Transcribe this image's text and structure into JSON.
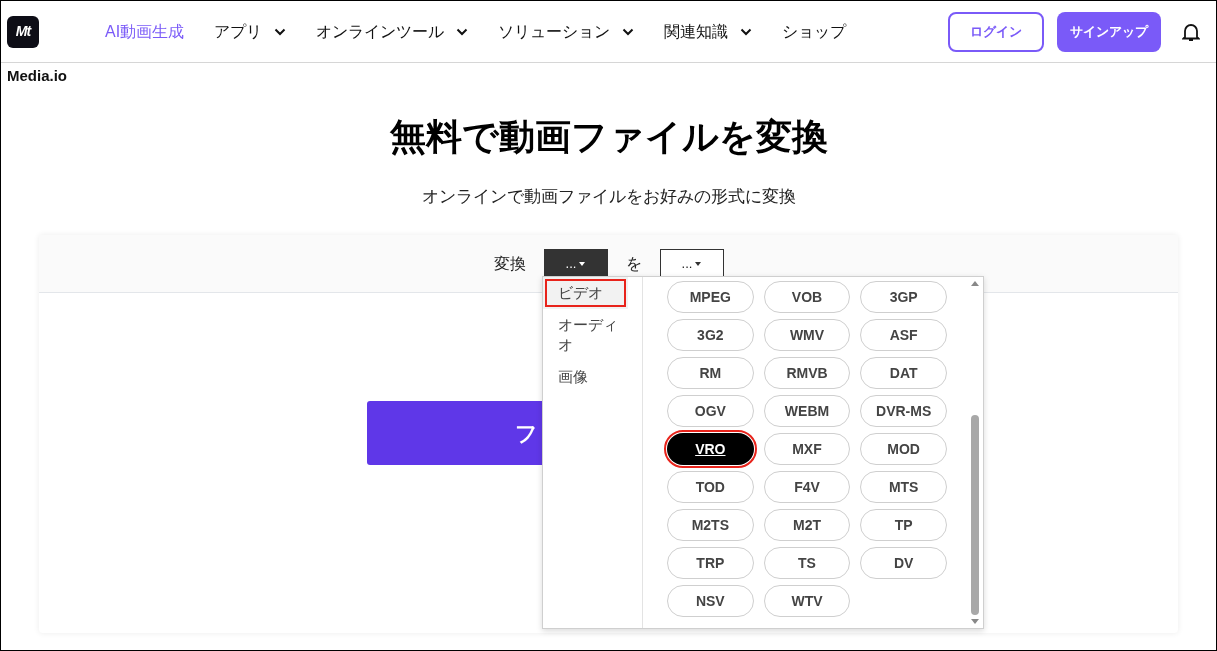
{
  "header": {
    "logo_text": "Mt",
    "nav": [
      {
        "label": "AI動画生成",
        "highlighted": true,
        "has_menu": false
      },
      {
        "label": "アプリ",
        "highlighted": false,
        "has_menu": true
      },
      {
        "label": "オンラインツール",
        "highlighted": false,
        "has_menu": true
      },
      {
        "label": "ソリューション",
        "highlighted": false,
        "has_menu": true
      },
      {
        "label": "関連知識",
        "highlighted": false,
        "has_menu": true
      },
      {
        "label": "ショップ",
        "highlighted": false,
        "has_menu": false
      }
    ],
    "login": "ログイン",
    "signup": "サインアップ"
  },
  "site_name": "Media.io",
  "title": "無料で動画ファイルを変換",
  "subtitle": "オンラインで動画ファイルをお好みの形式に変換",
  "converter": {
    "label_from": "変換",
    "from_value": "...",
    "label_to": "を",
    "to_value": "...",
    "upload_button": "フ"
  },
  "dropdown": {
    "categories": [
      {
        "label": "ビデオ",
        "selected": true,
        "annotated": true
      },
      {
        "label": "オーディオ",
        "selected": false,
        "annotated": false
      },
      {
        "label": "画像",
        "selected": false,
        "annotated": false
      }
    ],
    "formats": [
      {
        "label": "MPEG",
        "selected": false
      },
      {
        "label": "VOB",
        "selected": false
      },
      {
        "label": "3GP",
        "selected": false
      },
      {
        "label": "3G2",
        "selected": false
      },
      {
        "label": "WMV",
        "selected": false
      },
      {
        "label": "ASF",
        "selected": false
      },
      {
        "label": "RM",
        "selected": false
      },
      {
        "label": "RMVB",
        "selected": false
      },
      {
        "label": "DAT",
        "selected": false
      },
      {
        "label": "OGV",
        "selected": false
      },
      {
        "label": "WEBM",
        "selected": false
      },
      {
        "label": "DVR-MS",
        "selected": false
      },
      {
        "label": "VRO",
        "selected": true
      },
      {
        "label": "MXF",
        "selected": false
      },
      {
        "label": "MOD",
        "selected": false
      },
      {
        "label": "TOD",
        "selected": false
      },
      {
        "label": "F4V",
        "selected": false
      },
      {
        "label": "MTS",
        "selected": false
      },
      {
        "label": "M2TS",
        "selected": false
      },
      {
        "label": "M2T",
        "selected": false
      },
      {
        "label": "TP",
        "selected": false
      },
      {
        "label": "TRP",
        "selected": false
      },
      {
        "label": "TS",
        "selected": false
      },
      {
        "label": "DV",
        "selected": false
      },
      {
        "label": "NSV",
        "selected": false
      },
      {
        "label": "WTV",
        "selected": false
      }
    ]
  }
}
